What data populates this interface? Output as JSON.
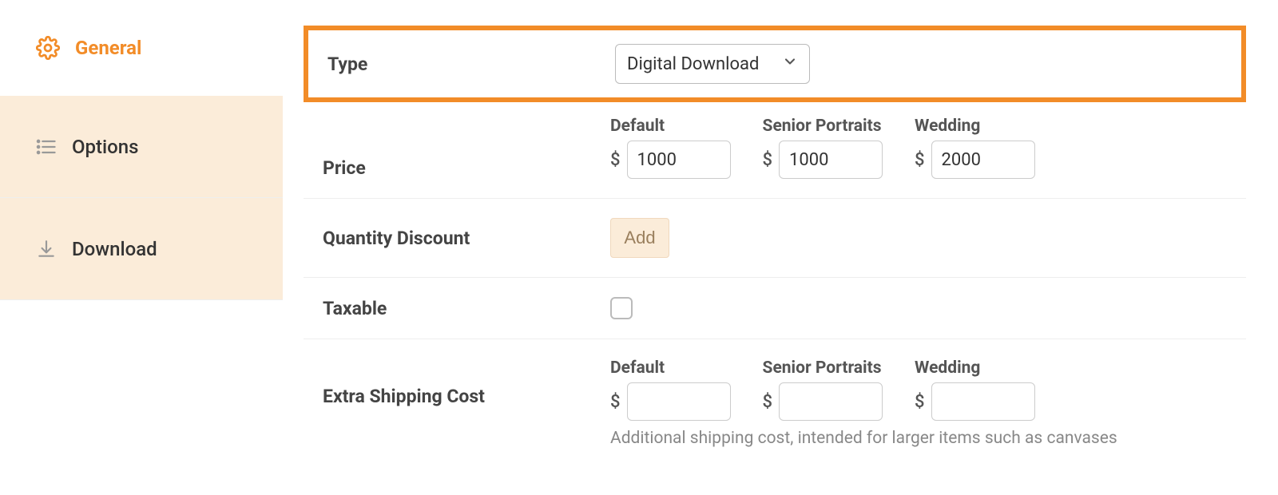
{
  "sidebar": {
    "general": "General",
    "options": "Options",
    "download": "Download"
  },
  "type": {
    "label": "Type",
    "value": "Digital Download"
  },
  "price": {
    "label": "Price",
    "columns": {
      "default": {
        "label": "Default",
        "value": "1000"
      },
      "senior": {
        "label": "Senior Portraits",
        "value": "1000"
      },
      "wedding": {
        "label": "Wedding",
        "value": "2000"
      }
    },
    "currency": "$"
  },
  "discount": {
    "label": "Quantity Discount",
    "add": "Add"
  },
  "taxable": {
    "label": "Taxable"
  },
  "shipping": {
    "label": "Extra Shipping Cost",
    "columns": {
      "default": {
        "label": "Default",
        "value": ""
      },
      "senior": {
        "label": "Senior Portraits",
        "value": ""
      },
      "wedding": {
        "label": "Wedding",
        "value": ""
      }
    },
    "hint": "Additional shipping cost, intended for larger items such as canvases"
  }
}
